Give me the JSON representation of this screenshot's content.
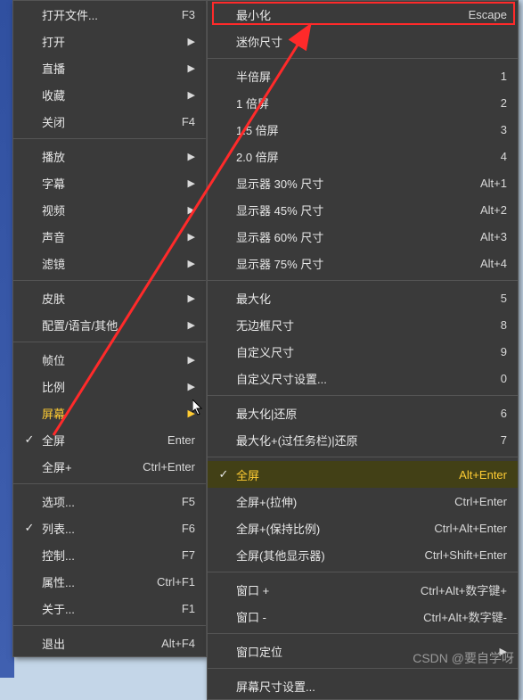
{
  "menu_left": {
    "items": [
      {
        "label": "打开文件...",
        "accel": "F3",
        "check": "",
        "sub": false
      },
      {
        "label": "打开",
        "accel": "",
        "check": "",
        "sub": true
      },
      {
        "label": "直播",
        "accel": "",
        "check": "",
        "sub": true
      },
      {
        "label": "收藏",
        "accel": "",
        "check": "",
        "sub": true
      },
      {
        "label": "关闭",
        "accel": "F4",
        "check": "",
        "sub": false
      }
    ],
    "items2": [
      {
        "label": "播放",
        "accel": "",
        "check": "",
        "sub": true
      },
      {
        "label": "字幕",
        "accel": "",
        "check": "",
        "sub": true
      },
      {
        "label": "视频",
        "accel": "",
        "check": "",
        "sub": true
      },
      {
        "label": "声音",
        "accel": "",
        "check": "",
        "sub": true
      },
      {
        "label": "滤镜",
        "accel": "",
        "check": "",
        "sub": true
      }
    ],
    "items3": [
      {
        "label": "皮肤",
        "accel": "",
        "check": "",
        "sub": true
      },
      {
        "label": "配置/语言/其他",
        "accel": "",
        "check": "",
        "sub": true
      }
    ],
    "items4": [
      {
        "label": "帧位",
        "accel": "",
        "check": "",
        "sub": true
      },
      {
        "label": "比例",
        "accel": "",
        "check": "",
        "sub": true
      },
      {
        "label": "屏幕",
        "accel": "",
        "check": "",
        "sub": true,
        "hl": true
      },
      {
        "label": "全屏",
        "accel": "Enter",
        "check": "✓",
        "sub": false
      },
      {
        "label": "全屏+",
        "accel": "Ctrl+Enter",
        "check": "",
        "sub": false
      }
    ],
    "items5": [
      {
        "label": "选项...",
        "accel": "F5",
        "check": "",
        "sub": false
      },
      {
        "label": "列表...",
        "accel": "F6",
        "check": "✓",
        "sub": false
      },
      {
        "label": "控制...",
        "accel": "F7",
        "check": "",
        "sub": false
      },
      {
        "label": "属性...",
        "accel": "Ctrl+F1",
        "check": "",
        "sub": false
      },
      {
        "label": "关于...",
        "accel": "F1",
        "check": "",
        "sub": false
      }
    ],
    "items6": [
      {
        "label": "退出",
        "accel": "Alt+F4",
        "check": "",
        "sub": false
      }
    ]
  },
  "menu_right": {
    "g1": [
      {
        "label": "最小化",
        "accel": "Escape"
      },
      {
        "label": "迷你尺寸",
        "accel": ""
      }
    ],
    "g2": [
      {
        "label": "半倍屏",
        "accel": "1"
      },
      {
        "label": "1 倍屏",
        "accel": "2"
      },
      {
        "label": "1.5 倍屏",
        "accel": "3"
      },
      {
        "label": "2.0 倍屏",
        "accel": "4"
      },
      {
        "label": "显示器 30% 尺寸",
        "accel": "Alt+1"
      },
      {
        "label": "显示器 45% 尺寸",
        "accel": "Alt+2"
      },
      {
        "label": "显示器 60% 尺寸",
        "accel": "Alt+3"
      },
      {
        "label": "显示器 75% 尺寸",
        "accel": "Alt+4"
      }
    ],
    "g3": [
      {
        "label": "最大化",
        "accel": "5"
      },
      {
        "label": "无边框尺寸",
        "accel": "8"
      },
      {
        "label": "自定义尺寸",
        "accel": "9"
      },
      {
        "label": "自定义尺寸设置...",
        "accel": "0"
      }
    ],
    "g4": [
      {
        "label": "最大化|还原",
        "accel": "6"
      },
      {
        "label": "最大化+(过任务栏)|还原",
        "accel": "7"
      }
    ],
    "g5": [
      {
        "label": "全屏",
        "accel": "Alt+Enter",
        "check": "✓",
        "hl": true
      },
      {
        "label": "全屏+(拉伸)",
        "accel": "Ctrl+Enter"
      },
      {
        "label": "全屏+(保持比例)",
        "accel": "Ctrl+Alt+Enter"
      },
      {
        "label": "全屏(其他显示器)",
        "accel": "Ctrl+Shift+Enter"
      }
    ],
    "g6": [
      {
        "label": "窗口 +",
        "accel": "Ctrl+Alt+数字键+"
      },
      {
        "label": "窗口 -",
        "accel": "Ctrl+Alt+数字键-"
      }
    ],
    "g7": [
      {
        "label": "窗口定位",
        "accel": "",
        "sub": true
      }
    ],
    "g8": [
      {
        "label": "屏幕尺寸设置...",
        "accel": ""
      }
    ]
  },
  "watermark": "CSDN @要自学呀"
}
